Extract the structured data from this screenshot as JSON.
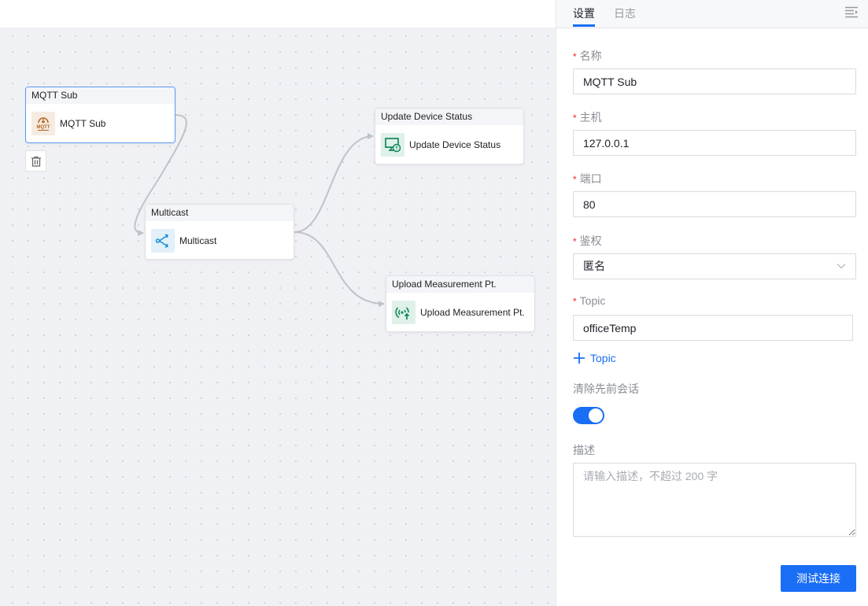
{
  "canvas": {
    "nodes": [
      {
        "id": "mqtt",
        "header": "MQTT Sub",
        "label": "MQTT Sub",
        "icon": "mqtt-icon",
        "icon_color": "#b5651d",
        "icon_bg": "#f5ebe0",
        "selected": true
      },
      {
        "id": "multicast",
        "header": "Multicast",
        "label": "Multicast",
        "icon": "multicast-icon",
        "icon_color": "#1a8fd6",
        "icon_bg": "#e2f0fa",
        "selected": false
      },
      {
        "id": "update",
        "header": "Update Device Status",
        "label": "Update Device Status",
        "icon": "device-status-icon",
        "icon_color": "#12875a",
        "icon_bg": "#dff1e9",
        "selected": false
      },
      {
        "id": "upload",
        "header": "Upload Measurement Pt.",
        "label": "Upload Measurement Pt.",
        "icon": "upload-signal-icon",
        "icon_color": "#12875a",
        "icon_bg": "#dff1e9",
        "selected": false
      }
    ],
    "edges": [
      {
        "from": "mqtt",
        "to": "multicast"
      },
      {
        "from": "multicast",
        "to": "update"
      },
      {
        "from": "multicast",
        "to": "upload"
      }
    ]
  },
  "panel": {
    "tabs": [
      {
        "label": "设置",
        "active": true
      },
      {
        "label": "日志",
        "active": false
      }
    ],
    "fields": {
      "name": {
        "label": "名称",
        "required": true,
        "value": "MQTT Sub"
      },
      "host": {
        "label": "主机",
        "required": true,
        "value": "127.0.0.1"
      },
      "port": {
        "label": "端口",
        "required": true,
        "value": "80"
      },
      "auth": {
        "label": "鉴权",
        "required": true,
        "value": "匿名"
      },
      "topic": {
        "label": "Topic",
        "required": true,
        "value": "officeTemp"
      },
      "add_topic_label": "Topic",
      "clean_session": {
        "label": "清除先前会话",
        "enabled": true
      },
      "description": {
        "label": "描述",
        "value": "",
        "placeholder": "请输入描述，不超过 200 字"
      }
    },
    "test_button": "测试连接",
    "accent_color": "#1a6ef5"
  }
}
